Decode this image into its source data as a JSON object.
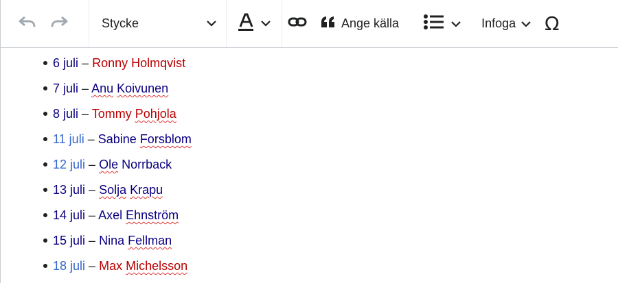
{
  "toolbar": {
    "undo_icon": "undo-icon",
    "redo_icon": "redo-icon",
    "paragraph_label": "Stycke",
    "text_style_icon": "text-style-A-icon",
    "link_icon": "link-icon",
    "cite_label": "Ange källa",
    "list_icon": "bullet-list-icon",
    "insert_label": "Infoga",
    "special_char_glyph": "Ω",
    "colors": {
      "text": "#202122",
      "disabled": "#a2a9b1",
      "border": "#c8ccd1"
    }
  },
  "list": [
    {
      "date": "6 juli",
      "sep": "–",
      "name_parts": [
        {
          "text": "Ronny Holmqvist",
          "style": "red",
          "spell": false
        }
      ],
      "date_style": "navy"
    },
    {
      "date": "7 juli",
      "sep": "–",
      "name_parts": [
        {
          "text": "Anu",
          "style": "navy",
          "spell": true
        },
        {
          "text": " ",
          "style": "navy",
          "spell": false
        },
        {
          "text": "Koivunen",
          "style": "navy",
          "spell": true
        }
      ],
      "date_style": "navy"
    },
    {
      "date": "8 juli",
      "sep": "–",
      "name_parts": [
        {
          "text": "Tommy ",
          "style": "red",
          "spell": false
        },
        {
          "text": "Pohjola",
          "style": "red",
          "spell": true
        }
      ],
      "date_style": "navy"
    },
    {
      "date": "11 juli",
      "sep": "–",
      "name_parts": [
        {
          "text": "Sabine ",
          "style": "navy",
          "spell": false
        },
        {
          "text": "Forsblom",
          "style": "navy",
          "spell": true
        }
      ],
      "date_style": "blue"
    },
    {
      "date": "12 juli",
      "sep": "–",
      "name_parts": [
        {
          "text": "Ole",
          "style": "navy",
          "spell": true
        },
        {
          "text": " Norrback",
          "style": "navy",
          "spell": false
        }
      ],
      "date_style": "blue"
    },
    {
      "date": "13 juli",
      "sep": "–",
      "name_parts": [
        {
          "text": "Solja",
          "style": "navy",
          "spell": true
        },
        {
          "text": " ",
          "style": "navy",
          "spell": false
        },
        {
          "text": "Krapu",
          "style": "navy",
          "spell": true
        }
      ],
      "date_style": "navy"
    },
    {
      "date": "14 juli",
      "sep": "–",
      "name_parts": [
        {
          "text": "Axel ",
          "style": "navy",
          "spell": false
        },
        {
          "text": "Ehnström",
          "style": "navy",
          "spell": true
        }
      ],
      "date_style": "navy"
    },
    {
      "date": "15 juli",
      "sep": "–",
      "name_parts": [
        {
          "text": "Nina ",
          "style": "navy",
          "spell": false
        },
        {
          "text": "Fellman",
          "style": "navy",
          "spell": true
        }
      ],
      "date_style": "navy"
    },
    {
      "date": "18 juli",
      "sep": "–",
      "name_parts": [
        {
          "text": "Max ",
          "style": "red",
          "spell": false
        },
        {
          "text": "Michelsson",
          "style": "red",
          "spell": true
        }
      ],
      "date_style": "blue"
    }
  ]
}
